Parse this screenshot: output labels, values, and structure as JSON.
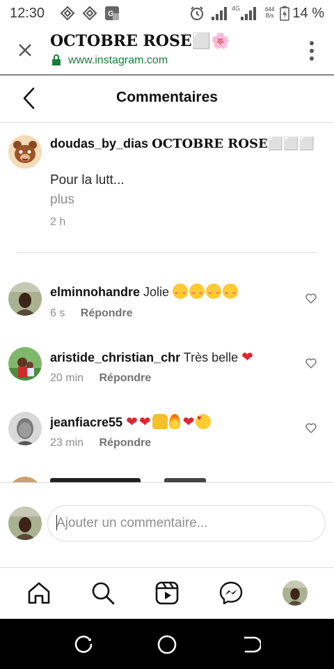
{
  "status_bar": {
    "time": "12:30",
    "network": "4G",
    "speed_top": "644",
    "speed_bottom": "B/s",
    "battery": "14 %"
  },
  "browser": {
    "title": "OCTOBRE ROSE⬜🌸",
    "url": "www.instagram.com",
    "close_icon": "close-icon",
    "menu_icon": "more-vert-icon"
  },
  "header": {
    "title": "Commentaires"
  },
  "caption": {
    "username": "doudas_by_dias",
    "title_text": "OCTOBRE ROSE⬜⬜⬜",
    "text": "Pour la lutt...",
    "more": "plus",
    "time": "2 h"
  },
  "comments": [
    {
      "username": "elminnohandre",
      "text": "Jolie",
      "emojis": [
        "love",
        "love",
        "love",
        "love"
      ],
      "time": "6 s",
      "reply": "Répondre"
    },
    {
      "username": "aristide_christian_chr",
      "text": "Très belle",
      "emojis": [
        "heart"
      ],
      "time": "20 min",
      "reply": "Répondre"
    },
    {
      "username": "jeanfiacre55",
      "text": "",
      "emojis": [
        "heart",
        "heart",
        "hands",
        "fire",
        "heart",
        "heart-eyes"
      ],
      "time": "23 min",
      "reply": "Répondre"
    }
  ],
  "compose": {
    "placeholder": "Ajouter un commentaire..."
  },
  "tabbar": {
    "items": [
      "home-icon",
      "search-icon",
      "reels-icon",
      "messenger-icon",
      "profile-avatar"
    ]
  },
  "colors": {
    "secure_green": "#1a7d3a",
    "heart_red": "#e0242e",
    "muted_text": "#8e8e8e"
  }
}
